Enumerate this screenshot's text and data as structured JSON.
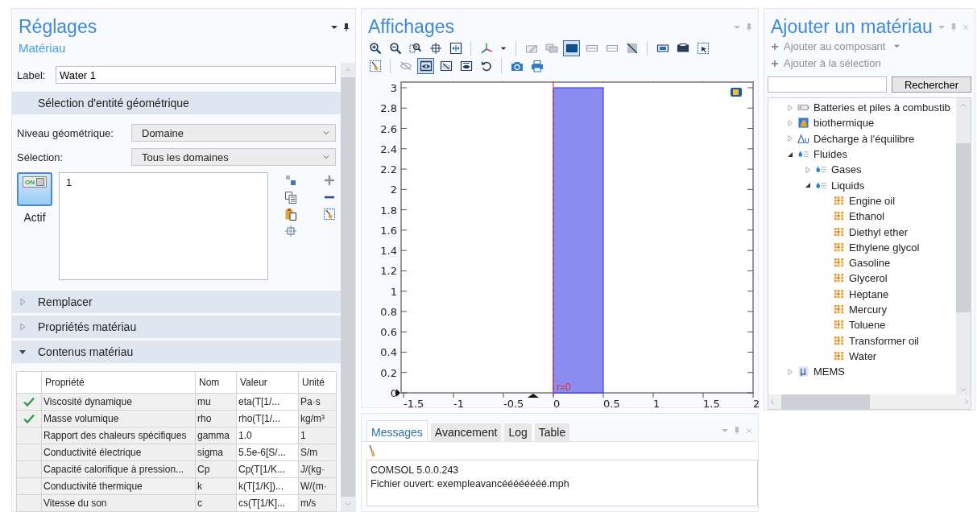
{
  "settings": {
    "title": "Réglages",
    "subtitle": "Matériau",
    "label_caption": "Label:",
    "label_value": "Water 1",
    "geometry_section": "Sélection d'entité géométrique",
    "level_caption": "Niveau géométrique:",
    "level_value": "Domaine",
    "selection_caption": "Sélection:",
    "selection_value": "Tous les domaines",
    "active": {
      "state_text": "ON",
      "label": "Actif",
      "on": true
    },
    "selection_list": [
      "1"
    ],
    "sections": [
      {
        "label": "Remplacer",
        "expanded": false
      },
      {
        "label": "Propriétés matériau",
        "expanded": false
      },
      {
        "label": "Contenus matériau",
        "expanded": true
      }
    ],
    "table": {
      "columns": [
        "Propriété",
        "Nom",
        "Valeur",
        "Unité"
      ],
      "rows": [
        {
          "checked": true,
          "property": "Viscosité dynamique",
          "name": "mu",
          "value": "eta(T[1/...",
          "unit": "Pa·s"
        },
        {
          "checked": true,
          "property": "Masse volumique",
          "name": "rho",
          "value": "rho(T[1/...",
          "unit": "kg/m³"
        },
        {
          "checked": false,
          "property": "Rapport des chaleurs spécifiques",
          "name": "gamma",
          "value": "1.0",
          "unit": "1"
        },
        {
          "checked": false,
          "property": "Conductivité électrique",
          "name": "sigma",
          "value": "5.5e-6[S/...",
          "unit": "S/m"
        },
        {
          "checked": false,
          "property": "Capacité calorifique à pression...",
          "name": "Cp",
          "value": "Cp(T[1/K...",
          "unit": "J/(kg·"
        },
        {
          "checked": false,
          "property": "Conductivité thermique",
          "name": "k",
          "value": "k(T[1/K])...",
          "unit": "W/(m·"
        },
        {
          "checked": false,
          "property": "Vitesse du son",
          "name": "c",
          "value": "cs(T[1/K]...",
          "unit": "m/s"
        }
      ]
    }
  },
  "graphics": {
    "title": "Affichages",
    "toolbar": [
      {
        "groups": [
          [
            {
              "kind": "zoom-in",
              "selected": false
            },
            {
              "kind": "zoom-out",
              "selected": false
            },
            {
              "kind": "zoom-box",
              "selected": false
            },
            {
              "kind": "crosshair",
              "selected": false
            },
            {
              "kind": "zoom-extents",
              "selected": false
            }
          ],
          [
            {
              "kind": "axes",
              "selected": false
            },
            {
              "kind": "caret",
              "selected": false
            }
          ],
          [
            {
              "kind": "pencil",
              "selected": false
            },
            {
              "kind": "overlap",
              "selected": false
            },
            {
              "kind": "solid",
              "selected": true
            },
            {
              "kind": "band",
              "selected": false
            },
            {
              "kind": "dashed-band",
              "selected": false
            },
            {
              "kind": "slash",
              "selected": false
            }
          ],
          [
            {
              "kind": "screen",
              "selected": false
            },
            {
              "kind": "dark-screen",
              "selected": false
            },
            {
              "kind": "select-box",
              "selected": false
            }
          ]
        ]
      },
      {
        "groups": [
          [
            {
              "kind": "broom-box",
              "selected": false
            }
          ],
          [
            {
              "kind": "hide",
              "selected": false
            },
            {
              "kind": "eye",
              "selected": true
            },
            {
              "kind": "eye-slash-box",
              "selected": false
            },
            {
              "kind": "eye-box",
              "selected": false
            },
            {
              "kind": "reset",
              "selected": false
            }
          ],
          [
            {
              "kind": "camera",
              "selected": false
            },
            {
              "kind": "printer",
              "selected": false
            }
          ]
        ]
      }
    ],
    "plot": {
      "yticks": [
        "3",
        "2.8",
        "2.6",
        "2.4",
        "2.2",
        "2",
        "1.8",
        "1.6",
        "1.4",
        "1.2",
        "1",
        "0.8",
        "0.6",
        "0.4",
        "0.2",
        "0"
      ],
      "xticks": [
        "-1.5",
        "-1",
        "-0.5",
        "0",
        "0.5",
        "1",
        "1.5",
        "2"
      ],
      "axis_marker": "r=0"
    }
  },
  "messages": {
    "tabs": [
      {
        "label": "Messages",
        "selected": true
      },
      {
        "label": "Avancement",
        "selected": false
      },
      {
        "label": "Log",
        "selected": false
      },
      {
        "label": "Table",
        "selected": false
      }
    ],
    "lines": [
      "COMSOL 5.0.0.243",
      "Fichier ouvert: exempleavancéééééééé.mph"
    ]
  },
  "library": {
    "title": "Ajouter un matériau",
    "actions": [
      {
        "label": "Ajouter au composant",
        "disabled": true,
        "menu": true
      },
      {
        "label": "Ajouter à la sélection",
        "disabled": true,
        "menu": false
      }
    ],
    "search_button": "Rechercher",
    "tree": [
      {
        "label": "Batteries et piles à combustib",
        "kind": "battery",
        "expanded": false
      },
      {
        "label": "biothermique",
        "kind": "bio",
        "expanded": false
      },
      {
        "label": "Décharge à l'équilibre",
        "kind": "delta",
        "expanded": false
      },
      {
        "label": "Fluides",
        "kind": "fluid",
        "expanded": true,
        "children": [
          {
            "label": "Gases",
            "kind": "fluid",
            "expanded": false
          },
          {
            "label": "Liquids",
            "kind": "fluid",
            "expanded": true,
            "children": [
              {
                "label": "Engine oil",
                "kind": "material"
              },
              {
                "label": "Ethanol",
                "kind": "material"
              },
              {
                "label": "Diethyl ether",
                "kind": "material"
              },
              {
                "label": "Ethylene glycol",
                "kind": "material"
              },
              {
                "label": "Gasoline",
                "kind": "material"
              },
              {
                "label": "Glycerol",
                "kind": "material"
              },
              {
                "label": "Heptane",
                "kind": "material"
              },
              {
                "label": "Mercury",
                "kind": "material"
              },
              {
                "label": "Toluene",
                "kind": "material"
              },
              {
                "label": "Transformer oil",
                "kind": "material"
              },
              {
                "label": "Water",
                "kind": "material"
              }
            ]
          }
        ]
      },
      {
        "label": "MEMS",
        "kind": "mems",
        "expanded": false
      }
    ]
  }
}
